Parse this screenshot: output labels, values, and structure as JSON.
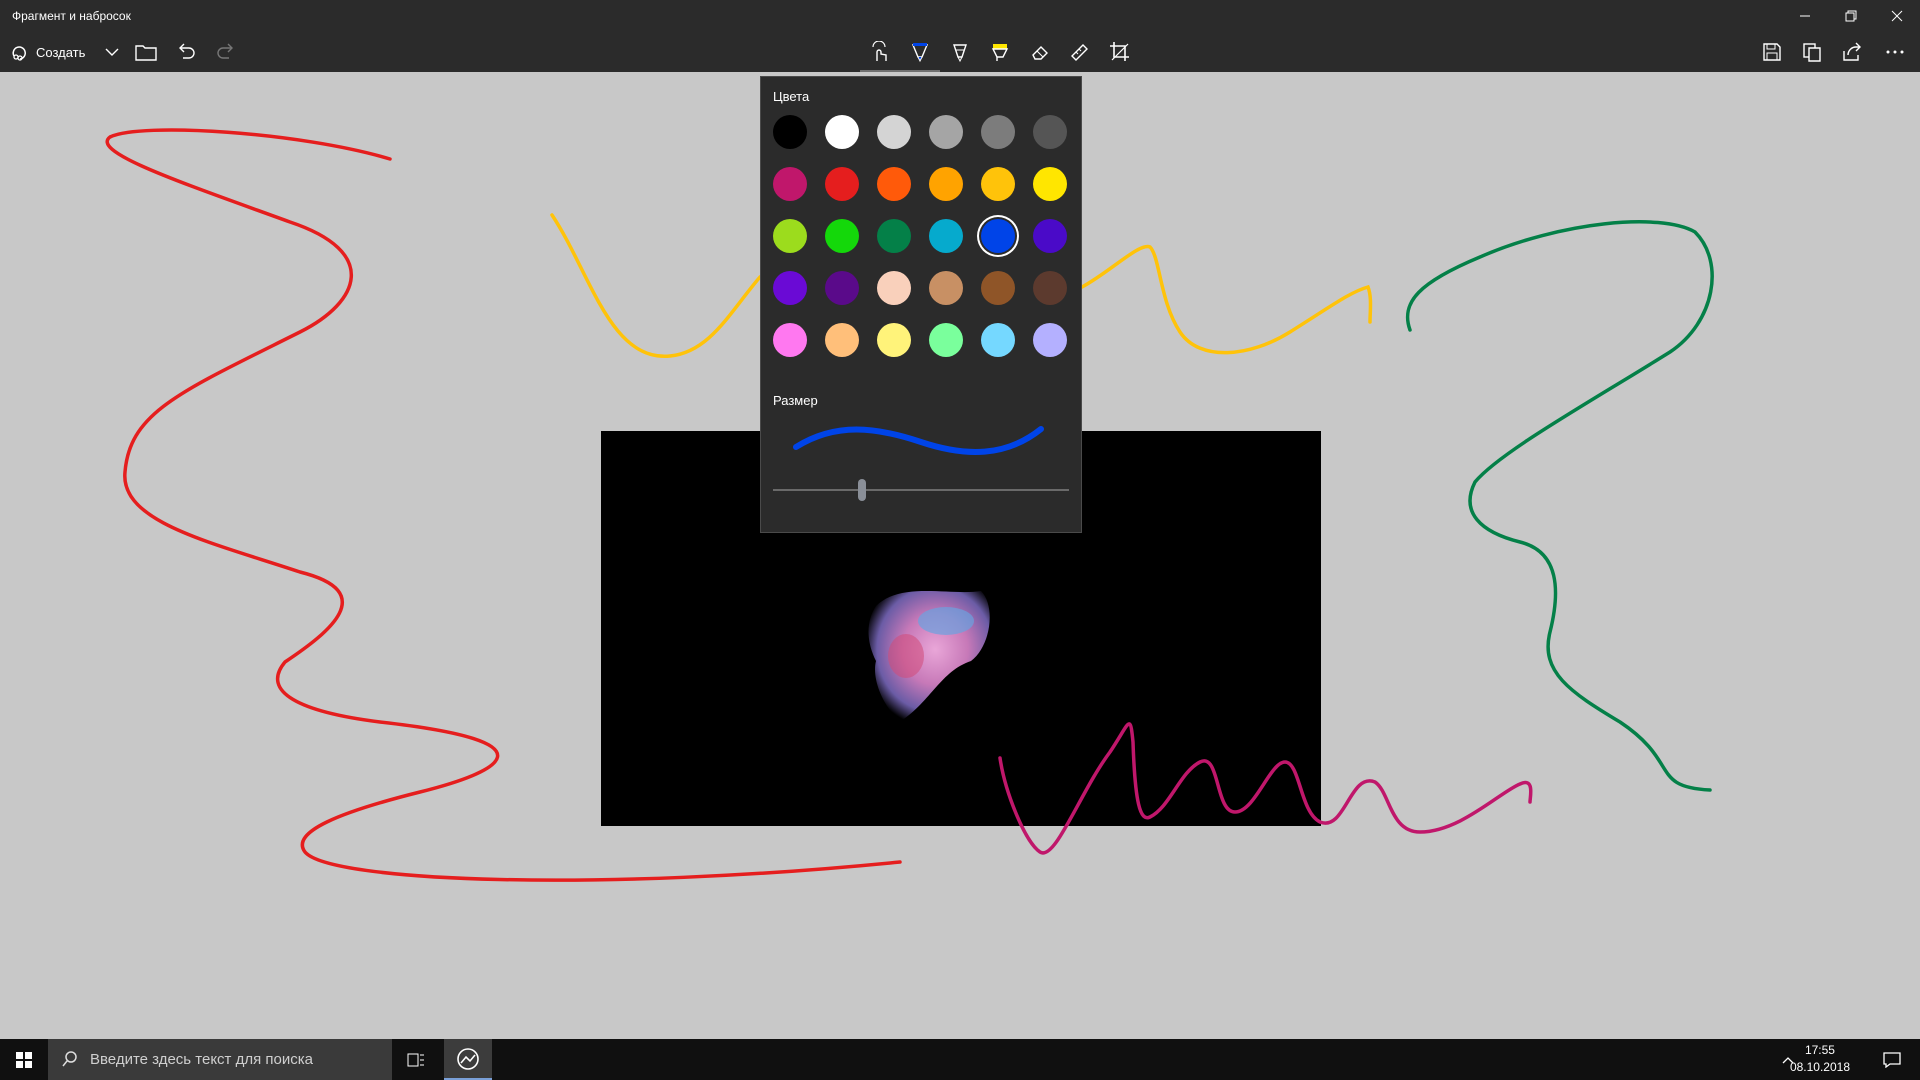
{
  "window": {
    "title": "Фрагмент и набросок"
  },
  "toolbar": {
    "create_label": "Создать"
  },
  "popup": {
    "colors_label": "Цвета",
    "size_label": "Размер",
    "selected_color": "#0044e8",
    "size_value_fraction": 0.3,
    "palette": [
      [
        "#000000",
        "#ffffff",
        "#d4d4d4",
        "#a5a5a5",
        "#7c7c7c",
        "#555555"
      ],
      [
        "#c0176b",
        "#e51e1e",
        "#ff5a0a",
        "#ffa300",
        "#ffc30a",
        "#ffe600"
      ],
      [
        "#9cdc1d",
        "#14d80a",
        "#048048",
        "#06aacd",
        "#0044e8",
        "#4a0ac8"
      ],
      [
        "#6a0ad5",
        "#5a0a8a",
        "#f9d0bb",
        "#c89064",
        "#8f5528",
        "#5c3a2e"
      ],
      [
        "#ff78f0",
        "#ffbf7a",
        "#fff37a",
        "#7aff9c",
        "#75d8ff",
        "#b4b0ff"
      ]
    ]
  },
  "taskbar": {
    "search_placeholder": "Введите здесь текст для поиска",
    "time": "17:55",
    "date": "08.10.2018"
  }
}
